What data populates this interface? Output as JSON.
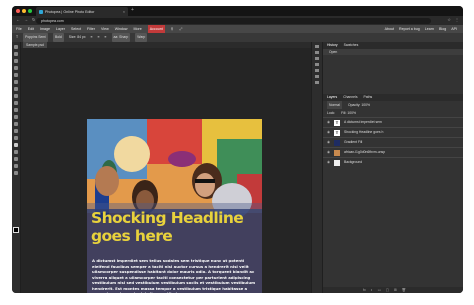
{
  "browser": {
    "tab_title": "Photopea | Online Photo Editor",
    "tab_close": "×",
    "new_tab": "+",
    "url": "photopea.com",
    "nav": [
      "←",
      "→",
      "↻"
    ],
    "right_icons": [
      "☆",
      "⋮"
    ]
  },
  "menu": {
    "items": [
      "File",
      "Edit",
      "Image",
      "Layer",
      "Select",
      "Filter",
      "View",
      "Window",
      "More",
      "Account"
    ],
    "right": [
      "About",
      "Report a bug",
      "Learn",
      "Blog",
      "API"
    ]
  },
  "options": {
    "font": "Poppins Semi",
    "style": "Bold",
    "size": "Size: 84 px",
    "aa": "aa: Sharp",
    "warp": "Warp"
  },
  "document": {
    "tab_label": "Sample.psd"
  },
  "artboard": {
    "headline": "Shocking Headline goes here",
    "body": "A dictumst imperdiet sem tellus sodales sem tristique nunc ut potenti eleifend faucibus semper a taciti nisi auctor cursus a hendrerit nisi velit ullamcorper suspendisse habitant dolor mauris odio. A torquent blandit ac viverra aliquet a ullamcorper taciti consectetur per parturient adipiscing vestibulum nisi sed vestibulum vestibulum sociis et vestibulum vestibulum hendrerit. Est montes massa tempor a vestibulum tristique habitasse a nunc placerat arcu in dui vitae vestibulum."
  },
  "panels": {
    "top_tabs": [
      "History",
      "Swatches"
    ],
    "history_item": "Open",
    "layer_tabs": [
      "Layers",
      "Channels",
      "Paths"
    ],
    "blend": "Normal",
    "opacity": "Opacity: 100%",
    "lock": "Lock:",
    "fill": "Fill: 100%",
    "layers": [
      {
        "name": "A dictumst imperdiet sem",
        "kind": "T"
      },
      {
        "name": "Shocking Headline goes h",
        "kind": "T"
      },
      {
        "name": "Gradient Fill",
        "kind": "G"
      },
      {
        "name": "african-l1g0d0n6fbvm-unsp",
        "kind": "I"
      },
      {
        "name": "Background",
        "kind": "I"
      }
    ],
    "bottom_icons": "fx ◐ ▭ ▢ ⊞ 🗑"
  },
  "colors": {
    "accent": "#c23a3a",
    "headline": "#e8d23c",
    "panel_bg": "#333333"
  }
}
